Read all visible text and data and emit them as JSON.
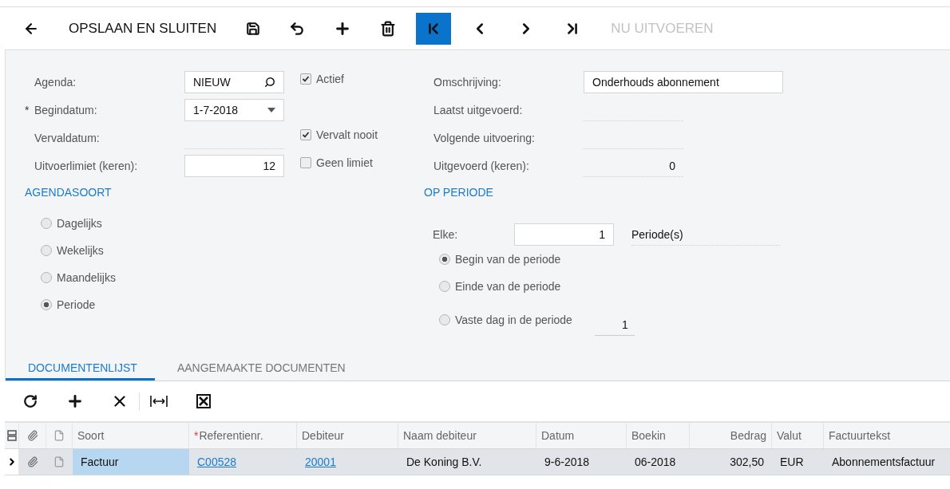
{
  "toolbar": [
    {
      "kind": "back"
    },
    {
      "kind": "text",
      "label": "OPSLAAN EN SLUITEN",
      "disabled": false
    },
    {
      "kind": "save"
    },
    {
      "kind": "undo"
    },
    {
      "kind": "add"
    },
    {
      "kind": "delete"
    },
    {
      "kind": "first",
      "highlighted": true
    },
    {
      "kind": "prev",
      "highlighted": false
    },
    {
      "kind": "next",
      "highlighted": false
    },
    {
      "kind": "last",
      "highlighted": false
    },
    {
      "kind": "text",
      "label": "NU UITVOEREN",
      "disabled": true
    }
  ],
  "form": {
    "rows": [
      {
        "label": "Agenda:",
        "field": {
          "kind": "lookup",
          "value": "NIEUW"
        },
        "checkbox": {
          "label": "Actief",
          "checked": true
        },
        "label2": "Omschrijving:",
        "field2": {
          "kind": "text",
          "value": "Onderhouds abonnement"
        }
      },
      {
        "required_mark": "*",
        "label": "Begindatum:",
        "field": {
          "kind": "date",
          "value": "1-7-2018"
        },
        "label2": "Laatst uitgevoerd:",
        "field2": {
          "kind": "readonly"
        }
      },
      {
        "label": "Vervaldatum:",
        "field": {
          "kind": "readonly"
        },
        "checkbox": {
          "label": "Vervalt nooit",
          "checked": true
        },
        "label2": "Volgende uitvoering:",
        "field2": {
          "kind": "readonly"
        }
      },
      {
        "label": "Uitvoerlimiet (keren):",
        "field": {
          "kind": "number",
          "value": "12"
        },
        "checkbox": {
          "label": "Geen limiet",
          "checked": false
        },
        "label2": "Uitgevoerd (keren):",
        "field2": {
          "kind": "readonly",
          "value": "0"
        }
      }
    ]
  },
  "schedule_type": {
    "title": "AGENDASOORT",
    "options": [
      {
        "label": "Dagelijks",
        "selected": false
      },
      {
        "label": "Wekelijks",
        "selected": false
      },
      {
        "label": "Maandelijks",
        "selected": false
      },
      {
        "label": "Periode",
        "selected": true
      }
    ]
  },
  "by_period": {
    "title": "OP PERIODE",
    "every_label": "Elke:",
    "every_value": "1",
    "unit": "Periode(s)",
    "options": [
      {
        "label": "Begin van de periode",
        "selected": true
      },
      {
        "label": "Einde van de periode",
        "selected": false
      },
      {
        "label": "Vaste dag in de periode",
        "selected": false,
        "value": "1"
      }
    ]
  },
  "tabs": [
    {
      "label": "DOCUMENTENLIJST",
      "selected": true
    },
    {
      "label": "AANGEMAAKTE DOCUMENTEN",
      "selected": false
    }
  ],
  "grid_toolbar": [
    {
      "kind": "refresh"
    },
    {
      "kind": "add"
    },
    {
      "kind": "remove"
    },
    {
      "kind": "separator"
    },
    {
      "kind": "fit"
    },
    {
      "kind": "excel"
    }
  ],
  "table": {
    "columns": [
      {
        "label": "Soort",
        "numeric": false
      },
      {
        "required_mark": "*",
        "label": "Referentienr.",
        "numeric": false
      },
      {
        "label": "Debiteur",
        "numeric": false
      },
      {
        "label": "Naam debiteur",
        "numeric": false
      },
      {
        "label": "Datum",
        "numeric": false
      },
      {
        "label": "Boekin",
        "numeric": false
      },
      {
        "label": "Bedrag",
        "numeric": true
      },
      {
        "label": "Valut",
        "numeric": false
      },
      {
        "label": "Factuurtekst",
        "numeric": false
      }
    ],
    "rows": [
      {
        "selected": true,
        "cells": [
          {
            "text": "Factuur",
            "link": false,
            "focused": true
          },
          {
            "text": "C00528",
            "link": true,
            "focused": false
          },
          {
            "text": "20001",
            "link": true,
            "focused": false
          },
          {
            "text": "De Koning B.V.",
            "link": false,
            "focused": false
          },
          {
            "text": "9-6-2018",
            "link": false,
            "focused": false
          },
          {
            "text": "06-2018",
            "link": false,
            "focused": false
          },
          {
            "text": "302,50",
            "link": false,
            "focused": false
          },
          {
            "text": "EUR",
            "link": false,
            "focused": false
          },
          {
            "text": "Abonnementsfactuur",
            "link": false,
            "focused": false
          }
        ]
      }
    ]
  }
}
